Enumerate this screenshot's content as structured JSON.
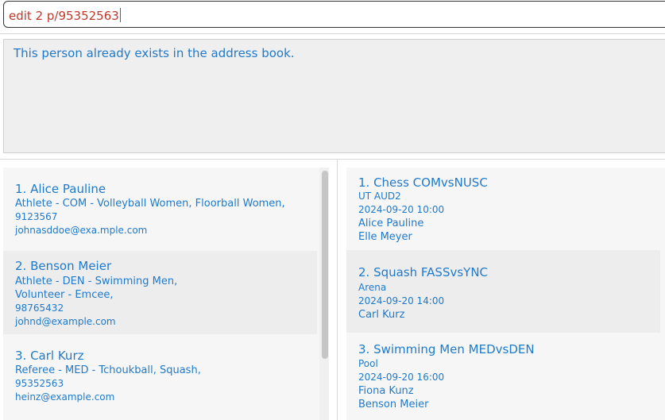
{
  "command_box": {
    "value": "edit 2 p/95352563"
  },
  "result_display": {
    "message": "This person already exists in the address book."
  },
  "persons": [
    {
      "index_name": "1. Alice Pauline",
      "roles": [
        "Athlete - COM - Volleyball Women, Floorball Women,"
      ],
      "phone": "9123567",
      "email": "johnasddoe@exa.mple.com"
    },
    {
      "index_name": "2. Benson Meier",
      "roles": [
        "Athlete - DEN - Swimming Men,",
        "Volunteer - Emcee,"
      ],
      "phone": "98765432",
      "email": "johnd@example.com"
    },
    {
      "index_name": "3. Carl Kurz",
      "roles": [
        "Referee - MED - Tchoukball, Squash,"
      ],
      "phone": "95352563",
      "email": "heinz@example.com"
    }
  ],
  "events": [
    {
      "index_title": "1. Chess COMvsNUSC",
      "venue": "UT AUD2",
      "datetime": "2024-09-20 10:00",
      "participants": [
        "Alice Pauline",
        "Elle Meyer"
      ]
    },
    {
      "index_title": "2. Squash FASSvsYNC",
      "venue": "Arena",
      "datetime": "2024-09-20 14:00",
      "participants": [
        "Carl Kurz"
      ]
    },
    {
      "index_title": "3. Swimming Men MEDvsDEN",
      "venue": "Pool",
      "datetime": "2024-09-20 16:00",
      "participants": [
        "Fiona Kunz",
        "Benson Meier"
      ]
    }
  ]
}
